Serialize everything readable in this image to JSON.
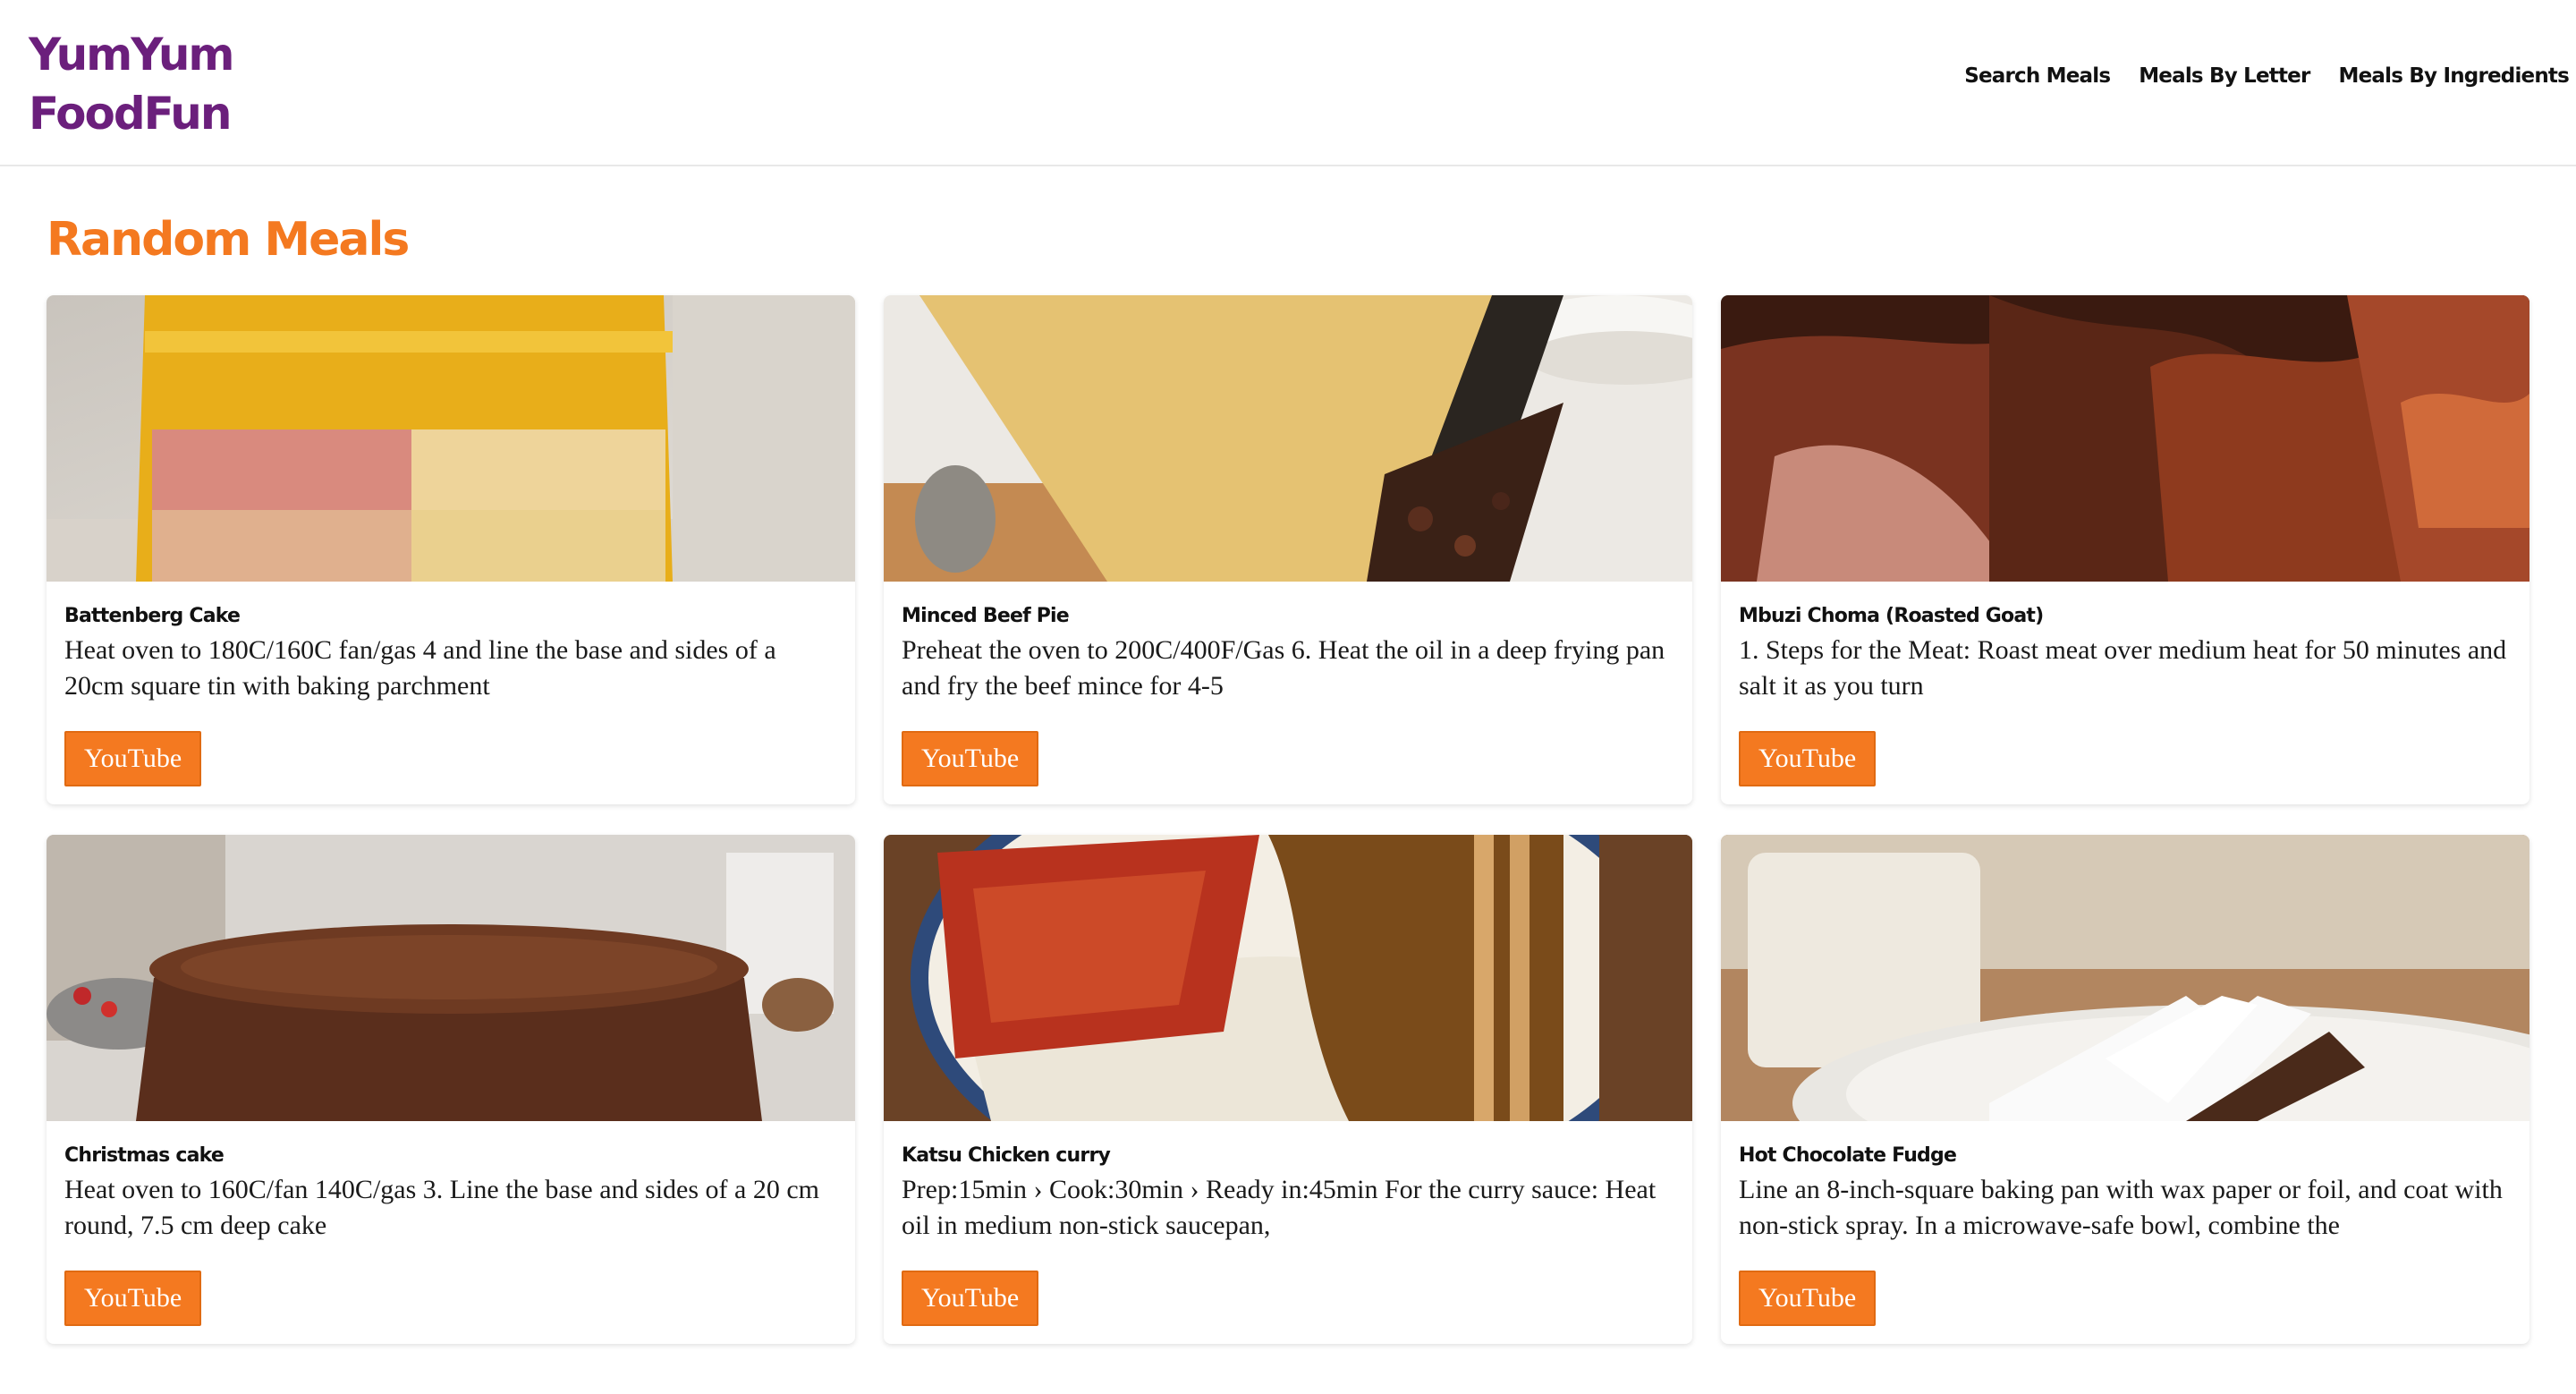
{
  "brand": {
    "line1": "YumYum",
    "line2": "FoodFun"
  },
  "nav": {
    "search": "Search Meals",
    "by_letter": "Meals By Letter",
    "by_ingredients": "Meals By Ingredients"
  },
  "section_title": "Random Meals",
  "meals": [
    {
      "title": "Battenberg Cake",
      "desc": "Heat oven to 180C/160C fan/gas 4 and line the base and sides of a 20cm square tin with baking parchment",
      "button": "YouTube"
    },
    {
      "title": "Minced Beef Pie",
      "desc": "Preheat the oven to 200C/400F/Gas 6. Heat the oil in a deep frying pan and fry the beef mince for 4-5",
      "button": "YouTube"
    },
    {
      "title": "Mbuzi Choma (Roasted Goat)",
      "desc": "1. Steps for the Meat: Roast meat over medium heat for 50 minutes and salt it as you turn",
      "button": "YouTube"
    },
    {
      "title": "Christmas cake",
      "desc": "Heat oven to 160C/fan 140C/gas 3. Line the base and sides of a 20 cm round, 7.5 cm deep cake",
      "button": "YouTube"
    },
    {
      "title": "Katsu Chicken curry",
      "desc": "Prep:15min › Cook:30min › Ready in:45min For the curry sauce: Heat oil in medium non-stick saucepan,",
      "button": "YouTube"
    },
    {
      "title": "Hot Chocolate Fudge",
      "desc": "Line an 8-inch-square baking pan with wax paper or foil, and coat with non-stick spray. In a microwave-safe bowl, combine the",
      "button": "YouTube"
    }
  ],
  "colors": {
    "brand": "#6b1f7c",
    "accent": "#f47920"
  }
}
